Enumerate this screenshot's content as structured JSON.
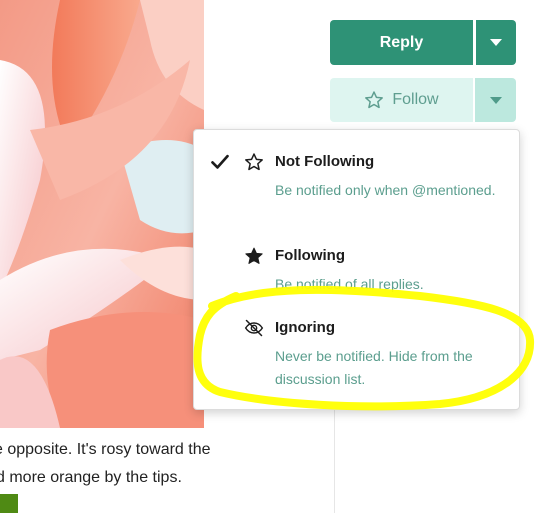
{
  "post": {
    "line1": "e opposite. It's rosy toward the",
    "line2": "d more orange by the tips."
  },
  "actions": {
    "reply_label": "Reply",
    "follow_label": "Follow"
  },
  "follow_menu": {
    "items": [
      {
        "title": "Not Following",
        "description": "Be notified only when @mentioned.",
        "icon": "star-outline-icon",
        "checked": true
      },
      {
        "title": "Following",
        "description": "Be notified of all replies.",
        "icon": "star-filled-icon",
        "checked": false
      },
      {
        "title": "Ignoring",
        "description": "Never be notified. Hide from the discussion list.",
        "icon": "eye-slash-icon",
        "checked": false
      }
    ]
  },
  "colors": {
    "primary": "#2e9276",
    "primary_light": "#def5f0",
    "description_text": "#5b9e8e",
    "highlight": "#ffff00"
  }
}
